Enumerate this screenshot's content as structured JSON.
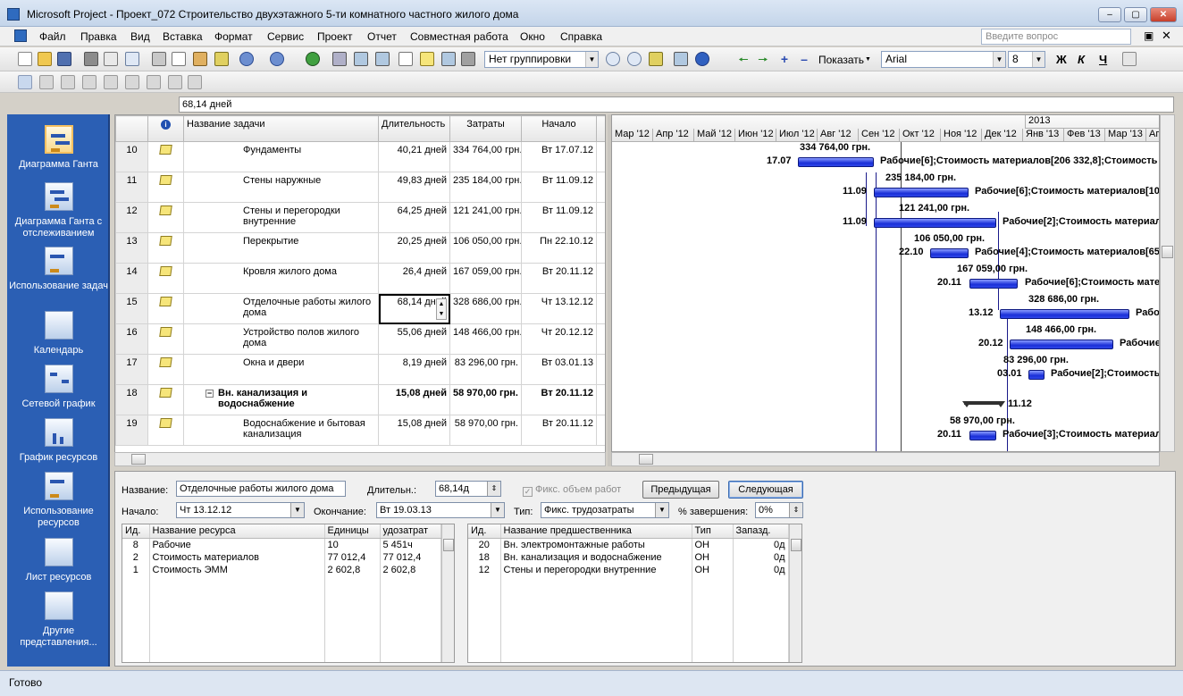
{
  "app": {
    "title": "Microsoft Project - Проект_072 Строительство двухэтажного 5-ти комнатного частного жилого дома",
    "ask_placeholder": "Введите вопрос"
  },
  "menu": [
    "Файл",
    "Правка",
    "Вид",
    "Вставка",
    "Формат",
    "Сервис",
    "Проект",
    "Отчет",
    "Совместная работа",
    "Окно",
    "Справка"
  ],
  "toolbar": {
    "grouping": "Нет группировки",
    "show_label": "Показать",
    "font": "Arial",
    "font_size": "8",
    "bold": "Ж",
    "italic": "К",
    "underline": "Ч"
  },
  "entry_value": "68,14 дней",
  "views": [
    {
      "label": "Диаграмма Ганта",
      "selected": true
    },
    {
      "label": "Диаграмма Ганта с отслеживанием"
    },
    {
      "label": "Использование задач"
    },
    {
      "label": "Календарь"
    },
    {
      "label": "Сетевой график"
    },
    {
      "label": "График ресурсов"
    },
    {
      "label": "Использование ресурсов"
    },
    {
      "label": "Лист ресурсов"
    },
    {
      "label": "Другие представления..."
    }
  ],
  "grid": {
    "headers": {
      "name": "Название задачи",
      "duration": "Длительность",
      "cost": "Затраты",
      "start": "Начало"
    },
    "rows": [
      {
        "id": "10",
        "name": "Фундаменты",
        "duration": "40,21 дней",
        "cost": "334 764,00 грн.",
        "start": "Вт 17.07.12"
      },
      {
        "id": "11",
        "name": "Стены наружные",
        "duration": "49,83 дней",
        "cost": "235 184,00 грн.",
        "start": "Вт 11.09.12"
      },
      {
        "id": "12",
        "name": "Стены и перегородки внутренние",
        "duration": "64,25 дней",
        "cost": "121 241,00 грн.",
        "start": "Вт 11.09.12"
      },
      {
        "id": "13",
        "name": "Перекрытие",
        "duration": "20,25 дней",
        "cost": "106 050,00 грн.",
        "start": "Пн 22.10.12"
      },
      {
        "id": "14",
        "name": "Кровля жилого дома",
        "duration": "26,4 дней",
        "cost": "167 059,00 грн.",
        "start": "Вт 20.11.12"
      },
      {
        "id": "15",
        "name": "Отделочные работы жилого дома",
        "duration": "68,14 дней",
        "cost": "328 686,00 грн.",
        "start": "Чт 13.12.12"
      },
      {
        "id": "16",
        "name": "Устройство полов жилого дома",
        "duration": "55,06 дней",
        "cost": "148 466,00 грн.",
        "start": "Чт 20.12.12"
      },
      {
        "id": "17",
        "name": "Окна и двери",
        "duration": "8,19 дней",
        "cost": "83 296,00 грн.",
        "start": "Вт 03.01.13"
      },
      {
        "id": "18",
        "name": "Вн. канализация и водоснабжение",
        "duration": "15,08 дней",
        "cost": "58 970,00 грн.",
        "start": "Вт 20.11.12",
        "summary": true
      },
      {
        "id": "19",
        "name": "Водоснабжение и бытовая канализация",
        "duration": "15,08 дней",
        "cost": "58 970,00 грн.",
        "start": "Вт 20.11.12"
      }
    ]
  },
  "gantt": {
    "year": "2013",
    "months": [
      "Мар '12",
      "Апр '12",
      "Май '12",
      "Июн '12",
      "Июл '12",
      "Авг '12",
      "Сен '12",
      "Окт '12",
      "Ноя '12",
      "Дек '12",
      "Янв '13",
      "Фев '13",
      "Мар '13",
      "Ап"
    ],
    "labels": {
      "r10_cost": "334 764,00 грн.",
      "r10_date": "17.07",
      "r10_res": "Рабочие[6];Стоимость материалов[206 332,8];Стоимость",
      "r11_cost": "235 184,00 грн.",
      "r11_date": "11.09",
      "r11_res": "Рабочие[6];Стоимость материалов[10",
      "r12_cost": "121 241,00 грн.",
      "r12_date": "11.09",
      "r12_res": "Рабочие[2];Стоимость материал",
      "r13_cost": "106 050,00 грн.",
      "r13_date": "22.10",
      "r13_res": "Рабочие[4];Стоимость материалов[65",
      "r14_cost": "167 059,00 грн.",
      "r14_date": "20.11",
      "r14_res": "Рабочие[6];Стоимость мате",
      "r15_cost": "328 686,00 грн.",
      "r15_date": "13.12",
      "r15_res": "Рабо",
      "r16_cost": "148 466,00 грн.",
      "r16_date": "20.12",
      "r16_res": "Рабочие",
      "r17_cost": "83 296,00 грн.",
      "r17_date": "03.01",
      "r17_res": "Рабочие[2];Стоимость",
      "r18_date": "11.12",
      "r19_cost": "58 970,00 грн.",
      "r19_date": "20.11",
      "r19_res": "Рабочие[3];Стоимость материал"
    }
  },
  "form": {
    "name_label": "Название:",
    "name_value": "Отделочные работы жилого дома",
    "duration_label": "Длительн.:",
    "duration_value": "68,14д",
    "fixed_work_label": "Фикс. объем работ",
    "prev_button": "Предыдущая",
    "next_button": "Следующая",
    "start_label": "Начало:",
    "start_value": "Чт 13.12.12",
    "finish_label": "Окончание:",
    "finish_value": "Вт 19.03.13",
    "type_label": "Тип:",
    "type_value": "Фикс. трудозатраты",
    "complete_label": "% завершения:",
    "complete_value": "0%",
    "res_headers": {
      "id": "Ид.",
      "name": "Название ресурса",
      "units": "Единицы",
      "work": "удозатрат"
    },
    "resources": [
      {
        "id": "8",
        "name": "Рабочие",
        "units": "10",
        "work": "5 451ч"
      },
      {
        "id": "2",
        "name": "Стоимость материалов",
        "units": "77 012,4",
        "work": "77 012,4"
      },
      {
        "id": "1",
        "name": "Стоимость ЭММ",
        "units": "2 602,8",
        "work": "2 602,8"
      }
    ],
    "pred_headers": {
      "id": "Ид.",
      "name": "Название предшественника",
      "type": "Тип",
      "lag": "Запазд."
    },
    "predecessors": [
      {
        "id": "20",
        "name": "Вн. электромонтажные работы",
        "type": "ОН",
        "lag": "0д"
      },
      {
        "id": "18",
        "name": "Вн. канализация и водоснабжение",
        "type": "ОН",
        "lag": "0д"
      },
      {
        "id": "12",
        "name": "Стены и перегородки внутренние",
        "type": "ОН",
        "lag": "0д"
      }
    ]
  },
  "status": "Готово"
}
